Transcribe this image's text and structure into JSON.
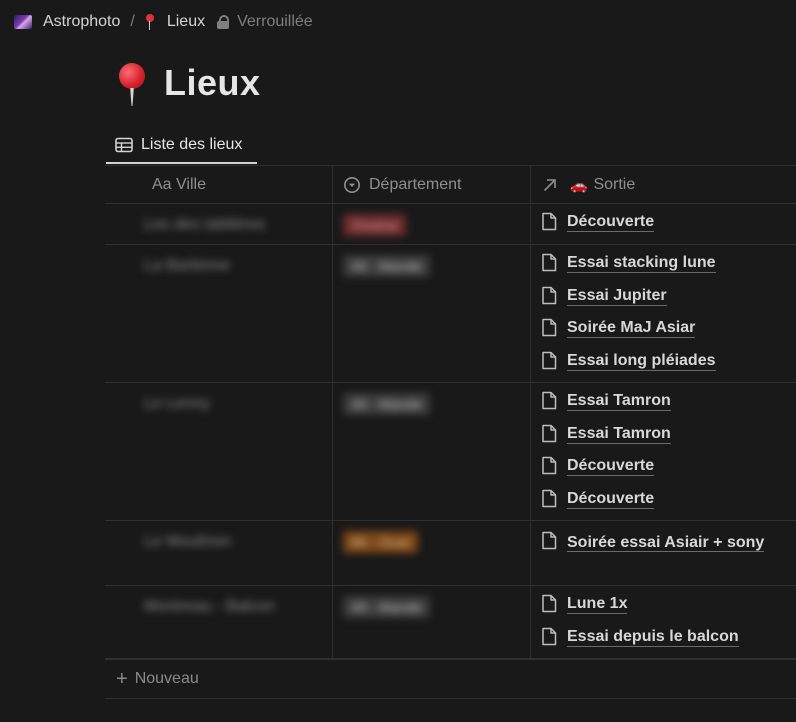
{
  "breadcrumb": {
    "workspace": "Astrophoto",
    "page": "Lieux",
    "status": "Verrouillée",
    "separator": "/"
  },
  "page": {
    "title": "Lieux"
  },
  "view_tab": {
    "label": "Liste des lieux"
  },
  "columns": {
    "ville": "Aa Ville",
    "departement": "Département",
    "sortie": "Sortie",
    "sortie_emoji": "🚗"
  },
  "rows": [
    {
      "ville": "Les des tablières",
      "departement": "Ossèse",
      "tag_color": "red",
      "sorties": [
        "Découverte"
      ]
    },
    {
      "ville": "La Barbinne",
      "departement": "49 - Mande",
      "tag_color": "gray",
      "sorties": [
        "Essai stacking lune",
        "Essai Jupiter",
        "Soirée MaJ Asiar",
        "Essai long pléiades"
      ]
    },
    {
      "ville": "Le Lenny",
      "departement": "49 - Mande",
      "tag_color": "gray",
      "sorties": [
        "Essai Tamron",
        "Essai Tamron",
        "Découverte",
        "Découverte"
      ]
    },
    {
      "ville": "Le Moulinon",
      "departement": "86 - Ouar",
      "tag_color": "orange",
      "sorties": [
        "Soirée essai Asiair + sony"
      ]
    },
    {
      "ville": "Montreau - Balcon",
      "departement": "49 - Mande",
      "tag_color": "gray",
      "sorties": [
        "Lune 1x",
        "Essai depuis le balcon"
      ]
    }
  ],
  "new_row": {
    "label": "Nouveau"
  },
  "colors": {
    "background": "#191919",
    "pin_red": "#e0323c"
  }
}
